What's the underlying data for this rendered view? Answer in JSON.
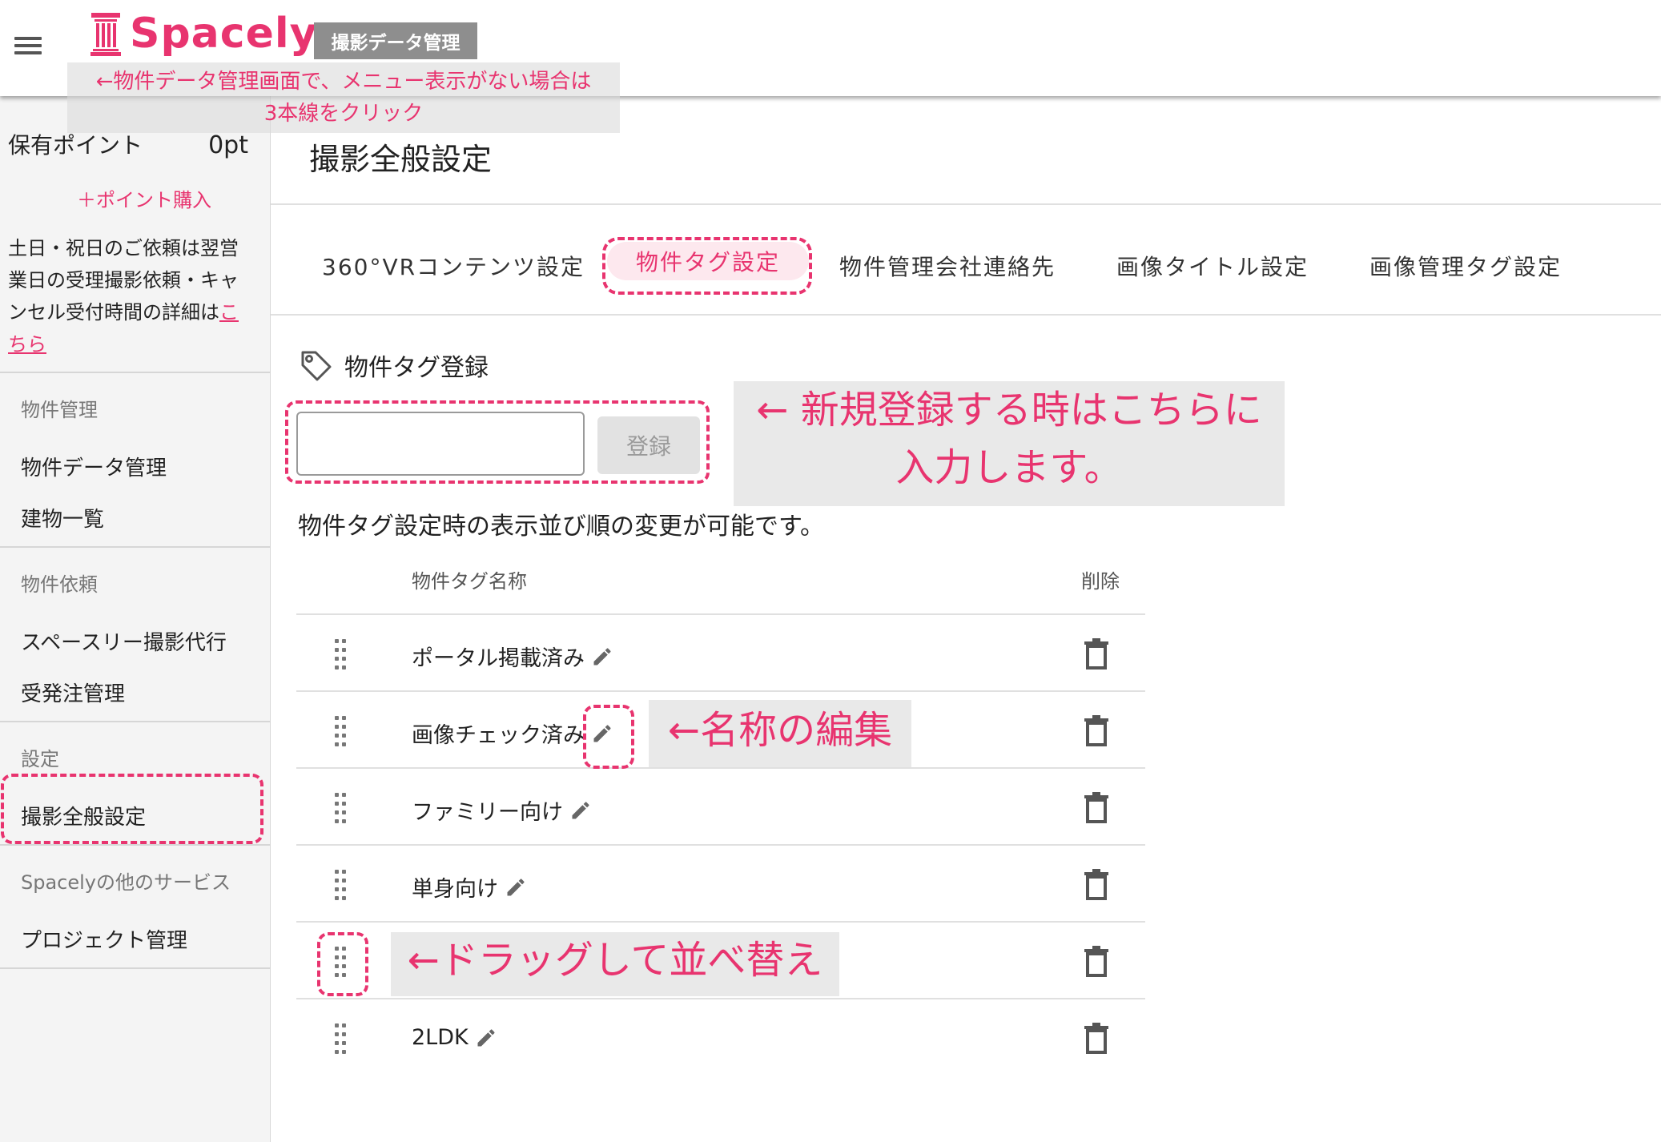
{
  "header": {
    "menu_icon": "hamburger-menu-icon",
    "logo_text": "Spacely",
    "logo_icon": "pillar-icon",
    "badge": "撮影データ管理"
  },
  "sidebar": {
    "points_label": "保有ポイント",
    "points_value": "0pt",
    "buy_points": "＋ポイント購入",
    "notice_text": "土日・祝日のご依頼は翌営業日の受理撮影依頼・キャンセル受付時間の詳細は",
    "notice_link": "こちら",
    "sections": [
      {
        "title": "物件管理",
        "items": [
          "物件データ管理",
          "建物一覧"
        ]
      },
      {
        "title": "物件依頼",
        "items": [
          "スペースリー撮影代行",
          "受発注管理"
        ]
      },
      {
        "title": "設定",
        "items": [
          "撮影全般設定"
        ]
      },
      {
        "title": "Spacelyの他のサービス",
        "items": [
          "プロジェクト管理"
        ]
      }
    ]
  },
  "main": {
    "page_title": "撮影全般設定",
    "tabs": [
      {
        "label": "360°VRコンテンツ設定",
        "active": false
      },
      {
        "label": "物件タグ設定",
        "active": true
      },
      {
        "label": "物件管理会社連絡先",
        "active": false
      },
      {
        "label": "画像タイトル設定",
        "active": false
      },
      {
        "label": "画像管理タグ設定",
        "active": false
      }
    ],
    "section_title": "物件タグ登録",
    "section_icon": "tag-icon",
    "input_value": "",
    "input_placeholder": "",
    "register_label": "登録",
    "order_note": "物件タグ設定時の表示並び順の変更が可能です。",
    "table": {
      "col_name": "物件タグ名称",
      "col_delete": "削除",
      "rows": [
        {
          "name": "ポータル掲載済み"
        },
        {
          "name": "画像チェック済み"
        },
        {
          "name": "ファミリー向け"
        },
        {
          "name": "単身向け"
        },
        {
          "name": ""
        },
        {
          "name": "2LDK"
        }
      ]
    }
  },
  "annotations": {
    "menu_hint": "←物件データ管理画面で、メニュー表示がない場合は\n3本線をクリック",
    "register_hint_line1": "← 新規登録する時はこちらに",
    "register_hint_line2": "入力します。",
    "edit_hint": "←名称の編集",
    "drag_hint": "←ドラッグして並べ替え"
  },
  "colors": {
    "accent": "#e8346f",
    "active_tab_bg": "#fde8ee",
    "badge_bg": "#8e8e8e",
    "sidebar_bg": "#f4f4f4"
  }
}
